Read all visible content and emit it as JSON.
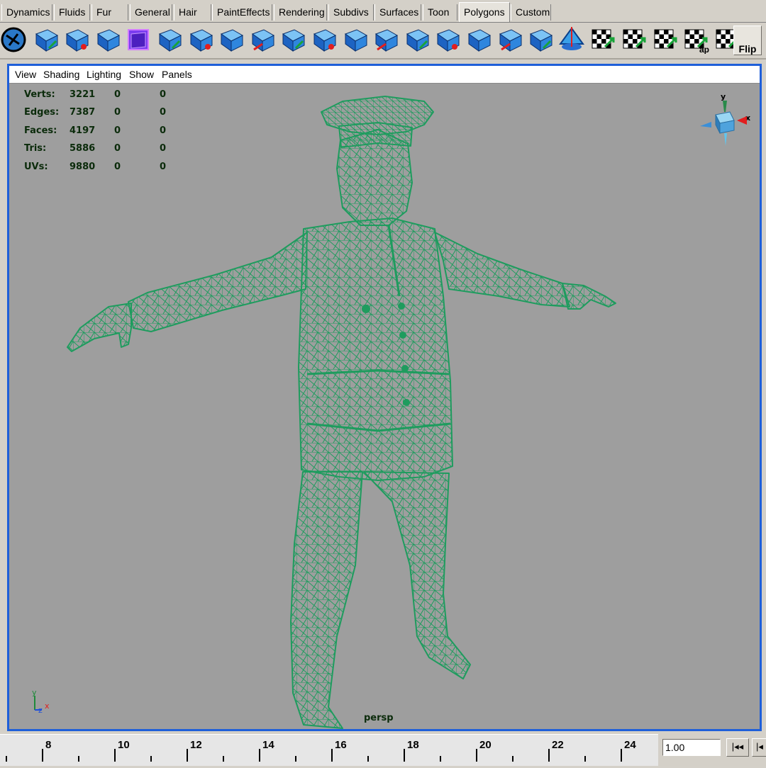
{
  "shelf": {
    "tabs": [
      {
        "label": "Dynamics",
        "active": false
      },
      {
        "label": "Fluids",
        "active": false
      },
      {
        "label": "Fur",
        "active": false
      },
      {
        "label": "General",
        "active": false
      },
      {
        "label": "Hair",
        "active": false
      },
      {
        "label": "PaintEffects",
        "active": false
      },
      {
        "label": "Rendering",
        "active": false
      },
      {
        "label": "Subdivs",
        "active": false
      },
      {
        "label": "Surfaces",
        "active": false
      },
      {
        "label": "Toon",
        "active": false
      },
      {
        "label": "Polygons",
        "active": true
      },
      {
        "label": "Custom",
        "active": false
      }
    ],
    "icons": [
      "select-by-component-icon",
      "append-polygon-icon",
      "extrude-face-icon",
      "split-polygon-icon",
      "create-polygon-cube-icon",
      "polygon-cube-icon",
      "wedge-face-icon",
      "bevel-icon",
      "duplicate-face-icon",
      "extract-icon",
      "poke-face-icon",
      "extrude-edge-icon",
      "merge-vertices-icon",
      "split-edge-ring-icon",
      "cut-faces-icon",
      "subdivide-icon",
      "combine-icon",
      "separate-icon",
      "smooth-icon",
      "planar-mapping-icon",
      "cylindrical-mapping-icon",
      "spherical-mapping-icon",
      "automatic-mapping-icon",
      "uv-texture-editor-icon"
    ],
    "icon_text": {
      "automatic_map": "ap"
    },
    "flip_label": "Flip"
  },
  "panel_menu": [
    "View",
    "Shading",
    "Lighting",
    "Show",
    "Panels"
  ],
  "hud": [
    {
      "label": "Verts:",
      "values": [
        "3221",
        "0",
        "0"
      ]
    },
    {
      "label": "Edges:",
      "values": [
        "7387",
        "0",
        "0"
      ]
    },
    {
      "label": "Faces:",
      "values": [
        "4197",
        "0",
        "0"
      ]
    },
    {
      "label": "Tris:",
      "values": [
        "5886",
        "0",
        "0"
      ]
    },
    {
      "label": "UVs:",
      "values": [
        "9880",
        "0",
        "0"
      ]
    }
  ],
  "view_cube": {
    "axis_y": "y",
    "axis_x": "x"
  },
  "corner_axis": {
    "y": "y",
    "x": "x",
    "z": "z"
  },
  "camera_label": "persp",
  "time_slider": {
    "labels": [
      "8",
      "10",
      "12",
      "14",
      "16",
      "18",
      "20",
      "22",
      "24"
    ],
    "current_time": "1.00"
  },
  "playback": {
    "step_back_icon": "|◂◂",
    "go_start_icon": "|◂"
  },
  "colors": {
    "viewport_bg": "#9e9e9e",
    "wireframe": "#1e9c5e",
    "panel_border": "#1f5fd9",
    "hud_text": "#0b2b0b"
  }
}
